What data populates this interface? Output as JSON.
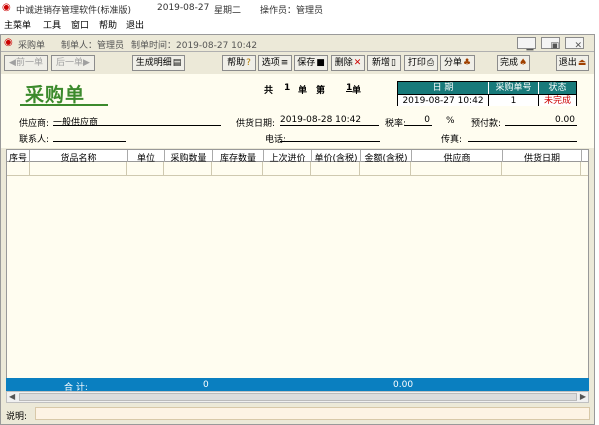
{
  "titlebar": {
    "app_title": "中诚进销存管理软件(标准版)",
    "date": "2019-08-27",
    "weekday": "星期二",
    "operator": "操作员：管理员"
  },
  "menu": [
    "主菜单",
    "工具",
    "窗口",
    "帮助",
    "退出"
  ],
  "doc_window": {
    "title": "采购单",
    "creator": "制单人：管理员",
    "created_at": "制单时间：2019-08-27 10:42"
  },
  "toolbar": {
    "prev": "前一单",
    "next": "后一单",
    "detail": "生成明细",
    "help": "帮助",
    "options": "选项",
    "save": "保存",
    "delete": "删除",
    "new": "新增",
    "print": "打印",
    "split": "分单",
    "done": "完成",
    "exit": "退出"
  },
  "form": {
    "title": "采购单",
    "page_prefix": "共",
    "page_total": "1",
    "page_unit": "单",
    "page_mid": "第",
    "page_current": "1",
    "page_suffix": "单",
    "supplier_label": "供应商:",
    "supplier_value": "一般供应商",
    "delivery_label": "供货日期:",
    "delivery_value": "2019-08-28 10:42",
    "tax_label": "税率:",
    "tax_value": "0",
    "tax_unit": "%",
    "prepay_label": "预付款:",
    "prepay_value": "0.00",
    "contact_label": "联系人:",
    "contact_value": "",
    "phone_label": "电话:",
    "phone_value": "",
    "fax_label": "传真:",
    "fax_value": ""
  },
  "info_table": {
    "headers": [
      "日 期",
      "采购单号",
      "状态"
    ],
    "values": [
      "2019-08-27 10:42",
      "1",
      "未完成"
    ],
    "status_color": "#cc0000"
  },
  "grid": {
    "columns": [
      "序号",
      "货品名称",
      "单位",
      "采购数量",
      "库存数量",
      "上次进价",
      "单价(含税)",
      "金额(含税)",
      "供应商",
      "供货日期"
    ]
  },
  "totals": {
    "label": "合 计:",
    "qty": "0",
    "amount": "0.00"
  },
  "status": {
    "note_label": "说明:",
    "note_value": ""
  },
  "colors": {
    "accent": "#187a7a",
    "total_bar": "#0a7fc0",
    "title_green": "#3c8a2c"
  }
}
